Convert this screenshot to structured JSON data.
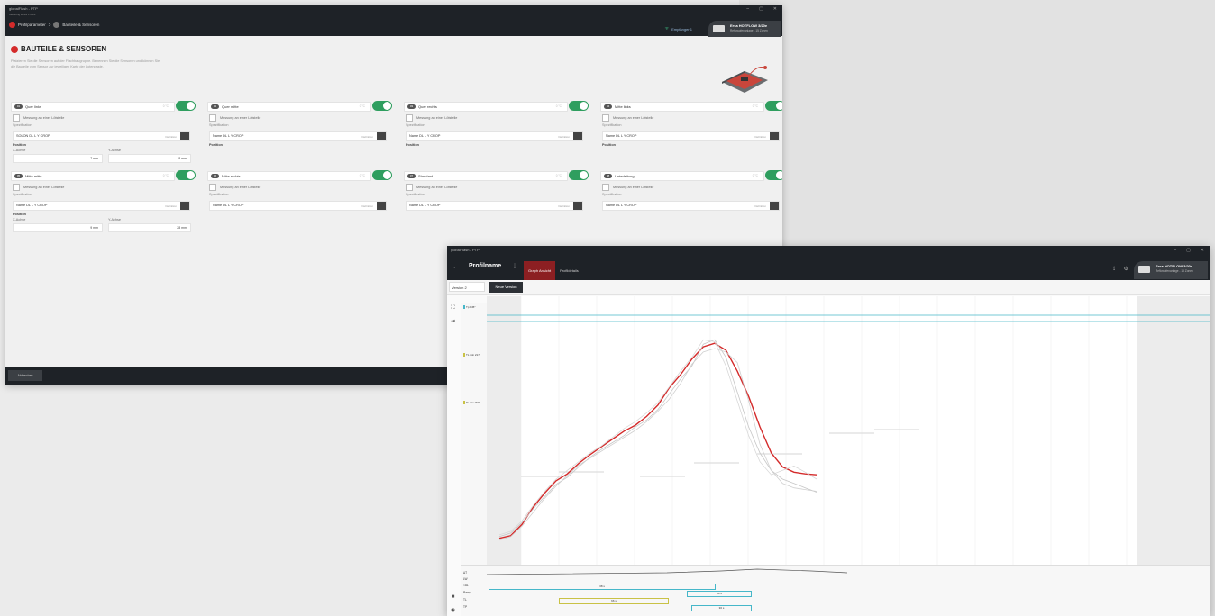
{
  "win1": {
    "app_title": "globalFlash - PTP",
    "subtitle": "Messung eines Profils",
    "breadcrumb": {
      "step1": "Profilparameter",
      "sep": ">",
      "step2": "Bauteile & Sensoren"
    },
    "window_controls": [
      "–",
      "▢",
      "✕"
    ],
    "receiver": "Empfänger 1",
    "device_name": "Ersa HOTFLOW 3/20e",
    "device_sub": "Reflowofenanlage - 15 Zonen",
    "heading": "BAUTEILE & SENSOREN",
    "intro": "Platzieren Sie die Sensoren auf der Flachbaugruppe. Benennen Sie die Sensoren und können Sie die Bauteile vom Sensor zur jeweiligen Karte der Lotenpaste.",
    "check_label": "Messung an einer Lötstelle",
    "spec_label": "Spezifikation",
    "spec_link": "Definition",
    "position_label": "Position",
    "x_label": "X-Achse",
    "y_label": "Y-Achse",
    "footer_button": "Abbrechen",
    "sensors": [
      {
        "num": "01",
        "name": "Quer links",
        "val": "0 °C",
        "spec": "SOLON DL L Y CROP",
        "x": "7 mm",
        "y": "8 mm"
      },
      {
        "num": "02",
        "name": "Quer mitte",
        "val": "0 °C",
        "spec": "Name DL L Y CROP"
      },
      {
        "num": "03",
        "name": "Quer rechts",
        "val": "0 °C",
        "spec": "Name DL L Y CROP"
      },
      {
        "num": "04",
        "name": "Mitte links",
        "val": "0 °C",
        "spec": "Name DL L Y CROP"
      },
      {
        "num": "05",
        "name": "Mitte mitte",
        "val": "0 °C",
        "spec": "Name DL L Y CROP",
        "x": "9 mm",
        "y": "28 mm"
      },
      {
        "num": "06",
        "name": "Mitte rechts",
        "val": "0 °C",
        "spec": "Name DL L Y CROP"
      },
      {
        "num": "07",
        "name": "Standard",
        "val": "0 °C",
        "spec": "Name DL L Y CROP"
      },
      {
        "num": "08",
        "name": "Unterleitung",
        "val": "0 °C",
        "spec": "Name DL L Y CROP"
      }
    ]
  },
  "win2": {
    "app_title": "globalFlash - PTP",
    "back": "←",
    "profile_name": "Profilname",
    "menu": "⋮",
    "tabs": [
      "Graph Ansicht",
      "Profildetails"
    ],
    "version": "Version 2",
    "new_version_button": "Neue Version",
    "device_name": "Ersa HOTFLOW 3/20e",
    "device_sub": "Reflowofenanlage - 15 Zonen",
    "legend": [
      {
        "num": "01",
        "name": "Quer links"
      },
      {
        "num": "02",
        "name": "Quer mitte"
      },
      {
        "num": "03",
        "name": "Quer rechts"
      },
      {
        "num": "04",
        "name": "Mitte links"
      },
      {
        "num": "05",
        "name": "Mitte mitte"
      },
      {
        "num": "06",
        "name": "Mitte rechts"
      },
      {
        "num": "07",
        "name": "Standard"
      },
      {
        "num": "08",
        "name": "Unterleitung"
      }
    ],
    "scale_boxes": [
      {
        "text": "Tp 245°",
        "color": "#46b7c9"
      },
      {
        "text": "TL min 217°",
        "color": "#c9c246"
      },
      {
        "text": "Ts min 150°",
        "color": "#c9c246"
      }
    ],
    "bottom_labels": [
      "ΔT",
      "LW",
      "TAL",
      "Ramp",
      "TL",
      "TP"
    ],
    "bottom_values": [
      "38 s",
      "60 s",
      "66 s",
      "30 s"
    ],
    "colors": {
      "accent": "#d42b2b",
      "cyan": "#46b7c9",
      "toggle": "#2f9e5f",
      "bar": "#1e2227"
    }
  },
  "chart_data": {
    "type": "line",
    "series": [
      {
        "values": [
          22,
          25,
          38,
          58,
          74,
          88,
          96,
          108,
          118,
          127,
          136,
          145,
          152,
          162,
          175,
          195,
          210,
          228,
          242,
          246,
          238,
          214,
          185,
          150,
          120,
          104,
          98,
          96,
          95
        ]
      },
      {
        "values": [
          24,
          28,
          40,
          56,
          70,
          84,
          92,
          104,
          115,
          124,
          132,
          140,
          150,
          158,
          170,
          188,
          205,
          220,
          245,
          250,
          230,
          190,
          150,
          120,
          100,
          90,
          85,
          80,
          75
        ]
      },
      {
        "values": [
          20,
          24,
          36,
          52,
          68,
          82,
          94,
          106,
          114,
          122,
          130,
          138,
          146,
          156,
          168,
          182,
          200,
          222,
          236,
          240,
          236,
          224,
          180,
          130,
          100,
          85,
          80,
          78,
          76
        ]
      },
      {
        "values": [
          26,
          30,
          42,
          60,
          76,
          90,
          100,
          110,
          120,
          128,
          138,
          148,
          156,
          166,
          178,
          196,
          214,
          230,
          250,
          248,
          220,
          180,
          140,
          110,
          95,
          100,
          105,
          98,
          90
        ]
      }
    ],
    "ylim": [
      0,
      300
    ]
  }
}
